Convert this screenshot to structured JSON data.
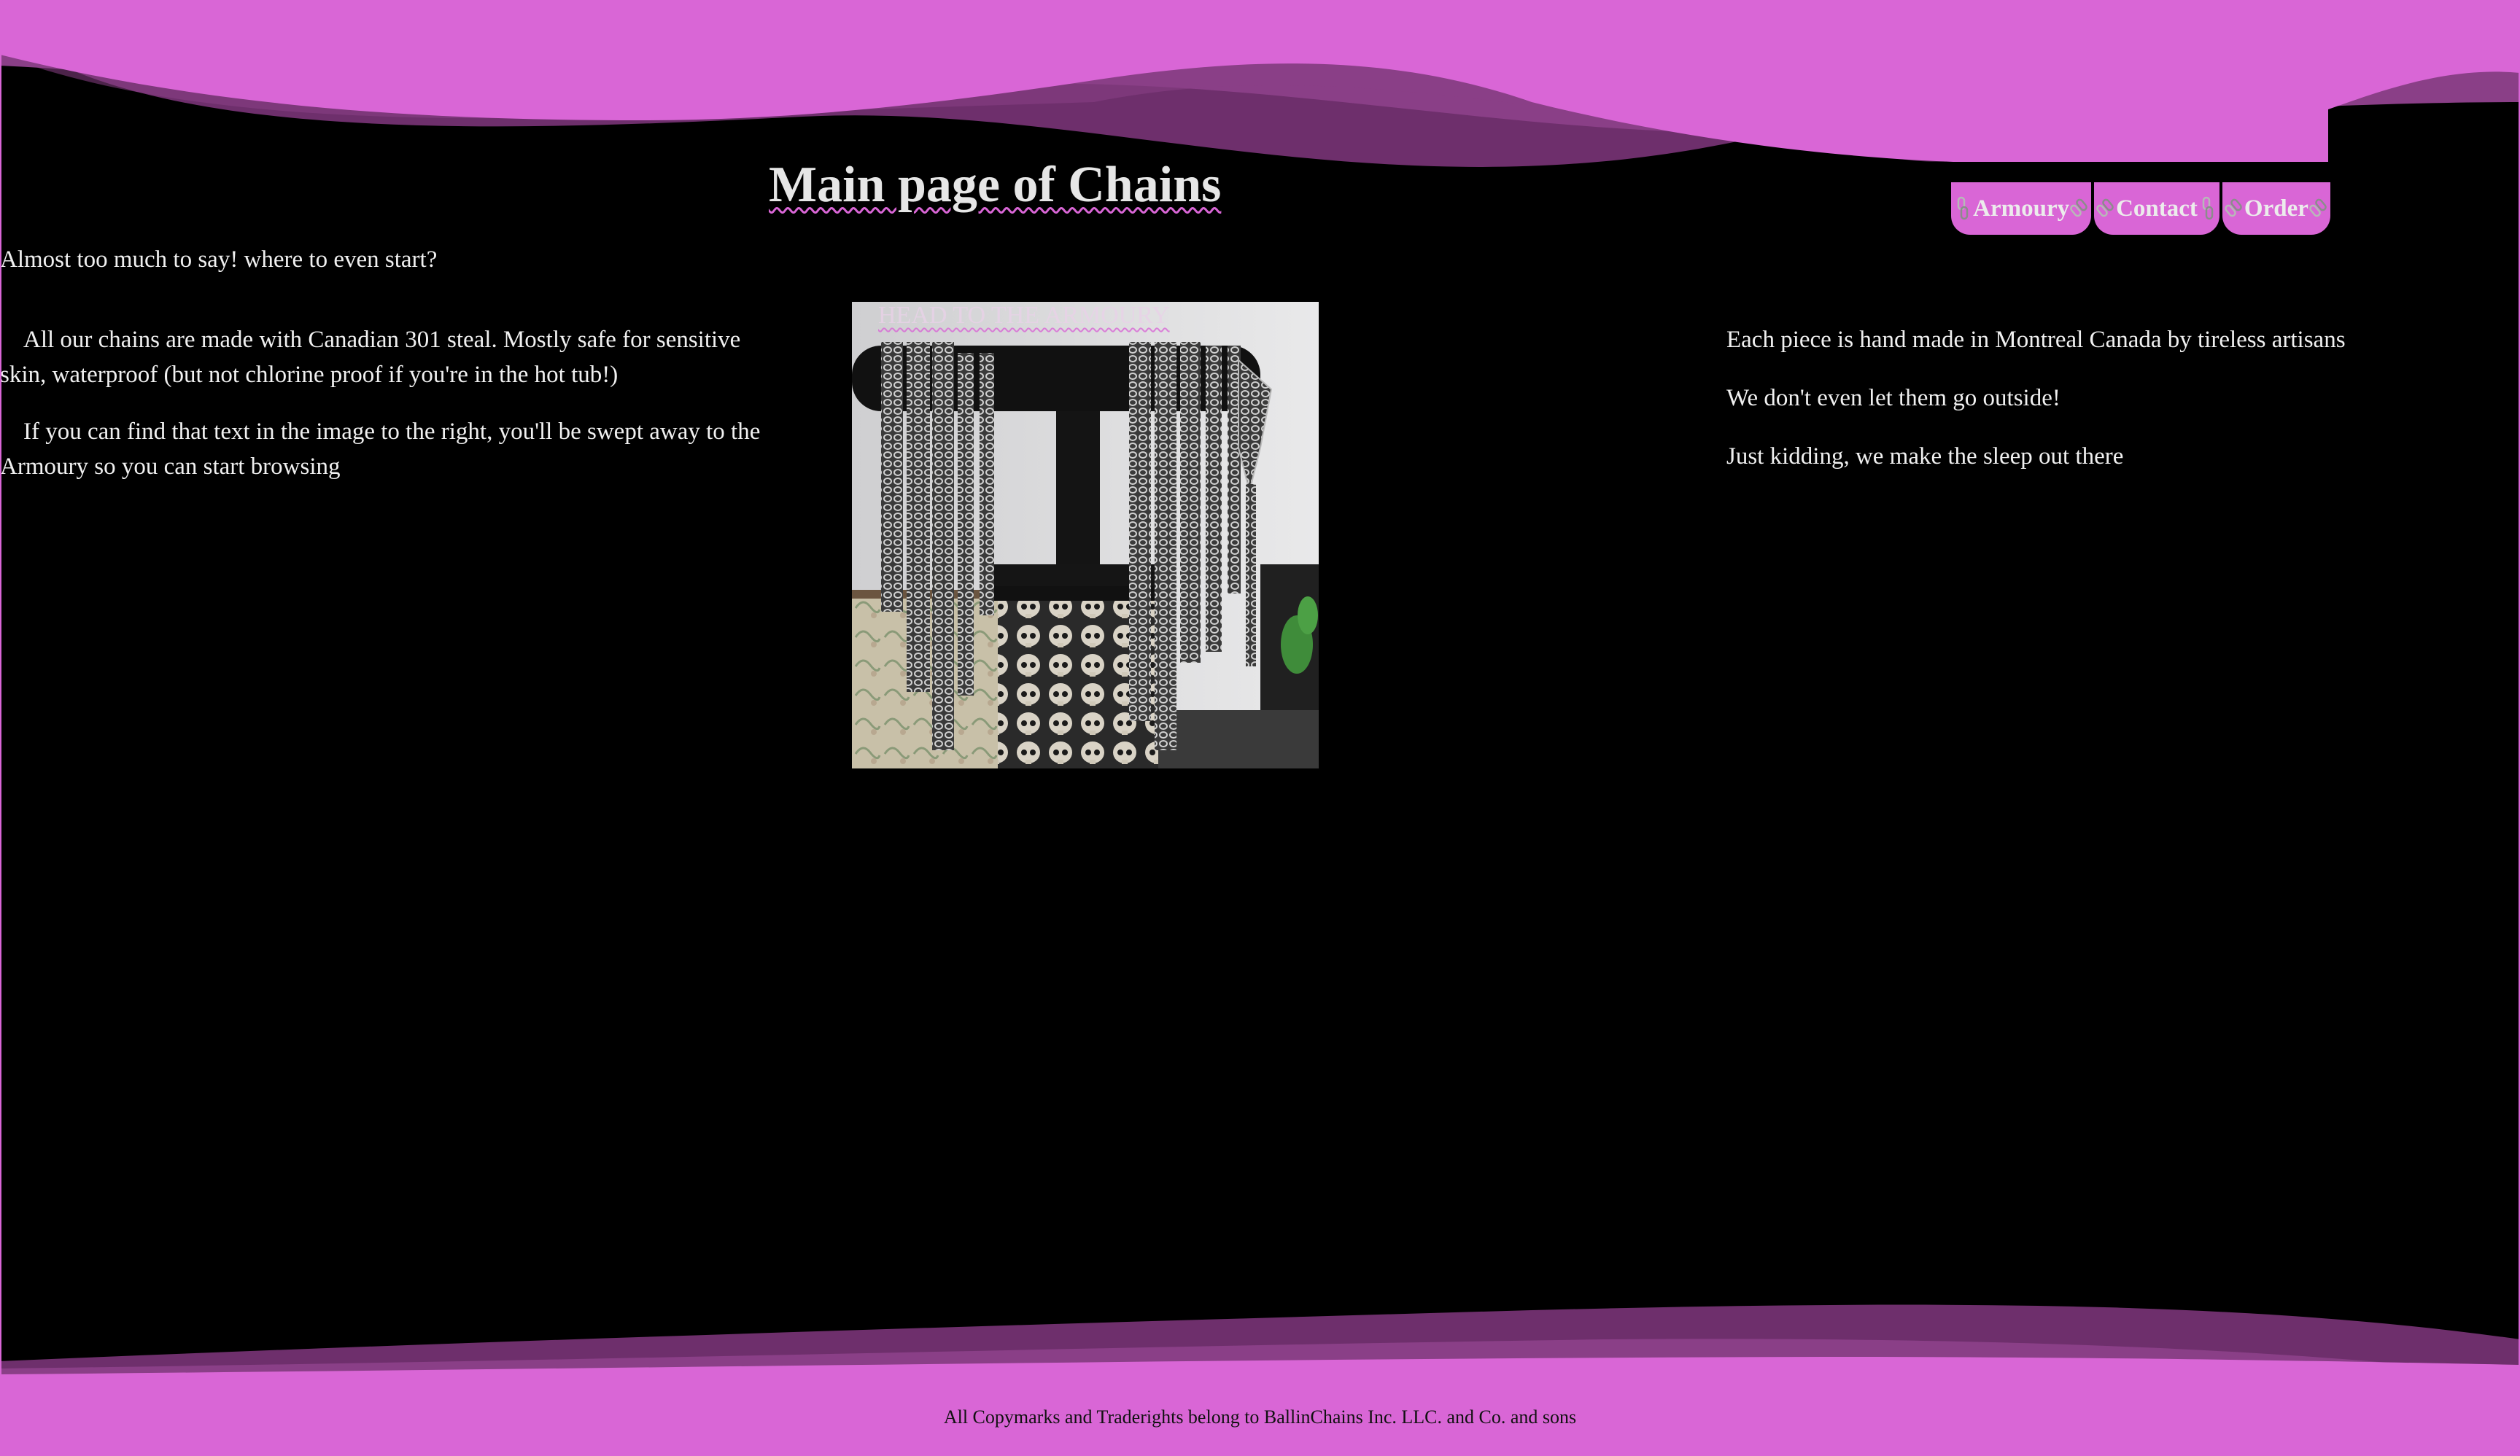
{
  "colors": {
    "accent": "#d966d6",
    "accent_dark": "#8a3f87",
    "background": "#000000",
    "text": "#f0f0f0"
  },
  "header": {
    "title": "Main page of Chains"
  },
  "nav": {
    "icon": "chain-icon",
    "items": [
      {
        "label": "Armoury"
      },
      {
        "label": "Contact"
      },
      {
        "label": "Order"
      }
    ]
  },
  "main": {
    "intro": "Almost too much to say! where to even start?",
    "left_paragraphs": [
      "All our chains are made with Canadian 301 steal. Mostly safe for sensitive skin, waterproof (but not chlorine proof if you're in the hot tub!)",
      "If you can find that text in the image to the right, you'll be swept away to the Armoury so you can start browsing"
    ],
    "image": {
      "caption": "HEAD TO THE ARMOURY",
      "icon": "chain-display-photo"
    },
    "right_paragraphs": [
      "Each piece is hand made in Montreal Canada by tireless artisans",
      "We don't even let them go outside!",
      "Just kidding, we make the sleep out there"
    ]
  },
  "footer": {
    "text": "All Copymarks and Traderights belong to BallinChains Inc. LLC. and Co. and sons"
  }
}
